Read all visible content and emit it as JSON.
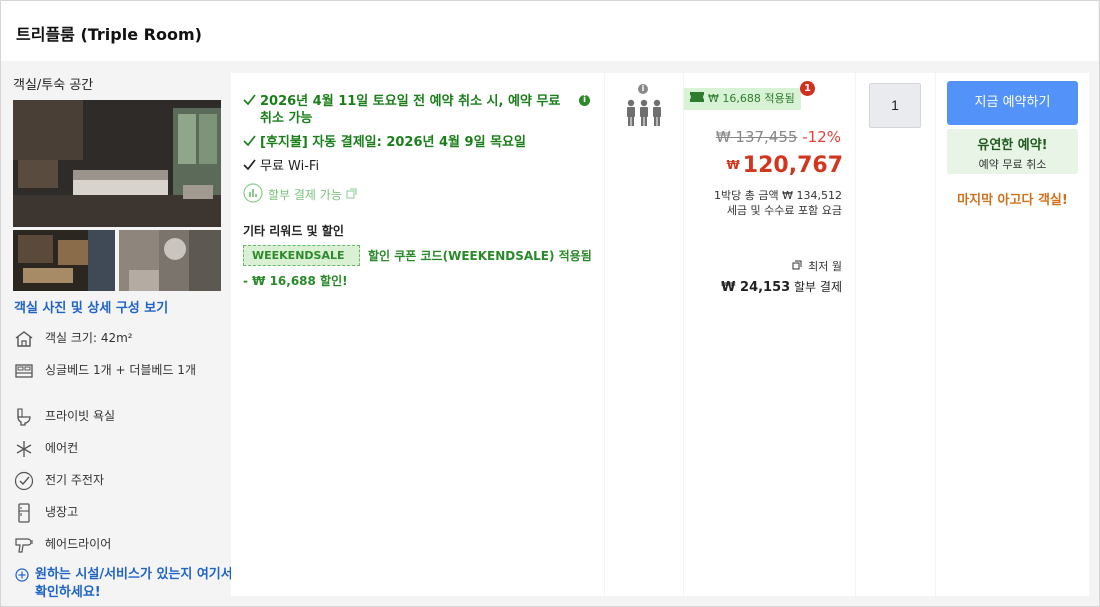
{
  "room": {
    "title": "트리플룸 (Triple Room)"
  },
  "left": {
    "section_title": "객실/투숙 공간",
    "photos_link": "객실 사진 및 상세 구성 보기",
    "amenities": [
      {
        "icon": "house-icon",
        "label": "객실 크기: 42m²"
      },
      {
        "icon": "bed-icon",
        "label": "싱글베드 1개 + 더블베드 1개"
      },
      {
        "icon": "toilet-icon",
        "label": "프라이빗 욕실"
      },
      {
        "icon": "snowflake-icon",
        "label": "에어컨"
      },
      {
        "icon": "kettle-icon",
        "label": "전기 주전자"
      },
      {
        "icon": "fridge-icon",
        "label": "냉장고"
      },
      {
        "icon": "hairdryer-icon",
        "label": "헤어드라이어"
      }
    ],
    "facility_link": "원하는 시설/서비스가 있는지 여기서 확인하세요!"
  },
  "conditions": {
    "cancel": "2026년 4월 11일 토요일 전 예약 취소 시, 예약 무료 취소 가능",
    "autopay": "[후지불] 자동 결제일: 2026년 4월 9일 목요일",
    "wifi": "무료 Wi-Fi",
    "installment": "할부 결제 가능",
    "other_title": "기타 리워드 및 할인",
    "coupon_code": "WEEKENDSALE",
    "coupon_text": "할인 쿠폰 코드(WEEKENDSALE) 적용됨",
    "discount": "- ₩ 16,688 할인!"
  },
  "occupancy": {
    "info": "i",
    "guests": 3
  },
  "price": {
    "applied_label": "₩ 16,688 적용됨",
    "applied_count": "1",
    "original": "₩ 137,455",
    "discount_pct": "-12%",
    "currency": "₩",
    "final": "120,767",
    "per_night": "1박당 총 금액 ₩ 134,512",
    "tax_note": "세금 및 수수료 포함 요금",
    "min_month": "최저 월",
    "monthly_amount": "₩ 24,153",
    "monthly_suffix": "할부 결제"
  },
  "quantity": {
    "value": "1"
  },
  "booking": {
    "button": "지금 예약하기",
    "flex_title": "유연한 예약!",
    "flex_sub": "예약 무료 취소",
    "last_room": "마지막 아고다 객실!"
  },
  "colors": {
    "accent": "#5392F9",
    "green": "#1A7F1A",
    "price_red": "#D2361E",
    "orange": "#D0701C",
    "link_blue": "#1F63C6"
  }
}
